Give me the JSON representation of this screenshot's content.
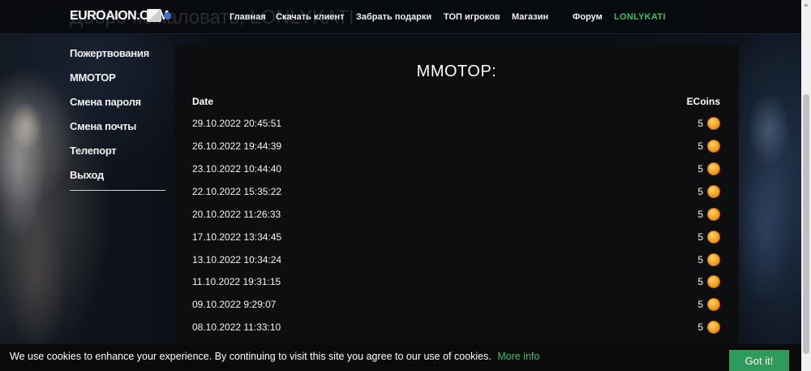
{
  "header": {
    "logo": "EUROAION.COM",
    "ghost_title": "Добро пожаловать, LONLYKATI",
    "nav": [
      {
        "label": "Главная"
      },
      {
        "label": "Скачать клиент"
      },
      {
        "label": "Забрать подарки"
      },
      {
        "label": "ТОП игроков"
      },
      {
        "label": "Магазин"
      },
      {
        "label": "Форум"
      },
      {
        "label": "LONLYKATI"
      }
    ]
  },
  "sidebar": {
    "items": [
      {
        "label": "Пожертвования"
      },
      {
        "label": "MMOTOP"
      },
      {
        "label": "Смена пароля"
      },
      {
        "label": "Смена почты"
      },
      {
        "label": "Телепорт"
      },
      {
        "label": "Выход"
      }
    ]
  },
  "main": {
    "title": "MMOTOP:",
    "columns": {
      "date": "Date",
      "ecoins": "ECoins"
    },
    "rows": [
      {
        "date": "29.10.2022 20:45:51",
        "amount": "5"
      },
      {
        "date": "26.10.2022 19:44:39",
        "amount": "5"
      },
      {
        "date": "23.10.2022 10:44:40",
        "amount": "5"
      },
      {
        "date": "22.10.2022 15:35:22",
        "amount": "5"
      },
      {
        "date": "20.10.2022 11:26:33",
        "amount": "5"
      },
      {
        "date": "17.10.2022 13:34:45",
        "amount": "5"
      },
      {
        "date": "13.10.2022 10:34:24",
        "amount": "5"
      },
      {
        "date": "11.10.2022 19:31:15",
        "amount": "5"
      },
      {
        "date": "09.10.2022 9:29:07",
        "amount": "5"
      },
      {
        "date": "08.10.2022 11:33:10",
        "amount": "5"
      }
    ],
    "coin_icon": "coin-icon"
  },
  "cookie": {
    "text": "We use cookies to enhance your experience. By continuing to visit this site you agree to our use of cookies.",
    "link": "More info",
    "button": "Got it!"
  },
  "colors": {
    "accent_green": "#35c06a",
    "button_green": "#2e9b5b",
    "coin_orange": "#f5a623"
  }
}
